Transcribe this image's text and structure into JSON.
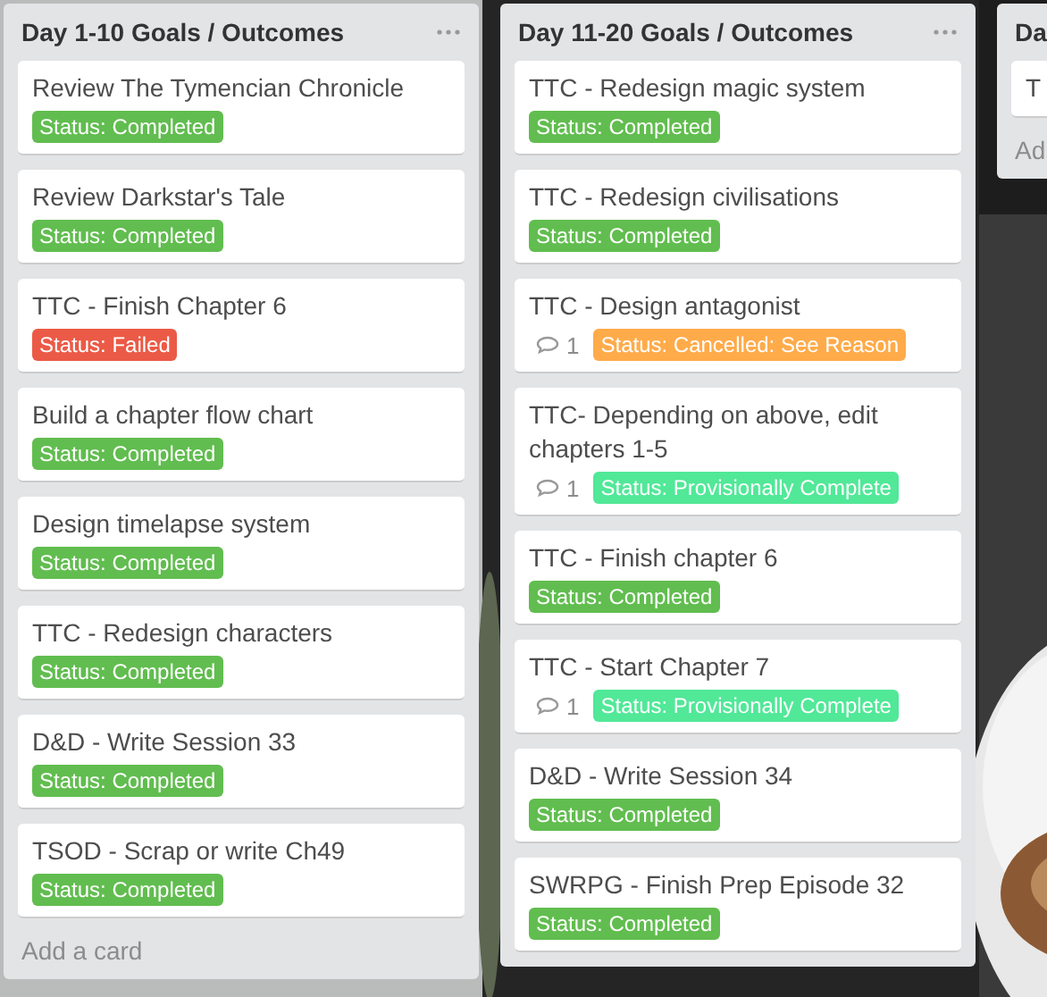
{
  "lists": [
    {
      "title": "Day 1-10 Goals / Outcomes",
      "menu": true,
      "cards": [
        {
          "title": "Review The Tymencian Chronicle",
          "labels": [
            {
              "text": "Status: Completed",
              "color": "#61bd4f"
            }
          ]
        },
        {
          "title": "Review Darkstar's Tale",
          "labels": [
            {
              "text": "Status: Completed",
              "color": "#61bd4f"
            }
          ]
        },
        {
          "title": "TTC - Finish Chapter 6",
          "labels": [
            {
              "text": "Status: Failed",
              "color": "#eb5a46"
            }
          ]
        },
        {
          "title": "Build a chapter flow chart",
          "labels": [
            {
              "text": "Status: Completed",
              "color": "#61bd4f"
            }
          ]
        },
        {
          "title": "Design timelapse system",
          "labels": [
            {
              "text": "Status: Completed",
              "color": "#61bd4f"
            }
          ]
        },
        {
          "title": "TTC - Redesign characters",
          "labels": [
            {
              "text": "Status: Completed",
              "color": "#61bd4f"
            }
          ]
        },
        {
          "title": "D&D - Write Session 33",
          "labels": [
            {
              "text": "Status: Completed",
              "color": "#61bd4f"
            }
          ]
        },
        {
          "title": "TSOD - Scrap or write Ch49",
          "labels": [
            {
              "text": "Status: Completed",
              "color": "#61bd4f"
            }
          ]
        }
      ],
      "add_card": "Add a card"
    },
    {
      "title": "Day 11-20 Goals / Outcomes",
      "menu": true,
      "cards": [
        {
          "title": "TTC - Redesign magic system",
          "labels": [
            {
              "text": "Status: Completed",
              "color": "#61bd4f"
            }
          ]
        },
        {
          "title": "TTC - Redesign civilisations",
          "labels": [
            {
              "text": "Status: Completed",
              "color": "#61bd4f"
            }
          ]
        },
        {
          "title": "TTC - Design antagonist",
          "comments": "1",
          "labels": [
            {
              "text": "Status: Cancelled: See Reason",
              "color": "#ffab4a"
            }
          ]
        },
        {
          "title": "TTC- Depending on above, edit chapters 1-5",
          "comments": "1",
          "labels": [
            {
              "text": "Status: Provisionally Complete",
              "color": "#51e898"
            }
          ]
        },
        {
          "title": "TTC - Finish chapter 6",
          "labels": [
            {
              "text": "Status: Completed",
              "color": "#61bd4f"
            }
          ]
        },
        {
          "title": "TTC - Start Chapter 7",
          "comments": "1",
          "labels": [
            {
              "text": "Status: Provisionally Complete",
              "color": "#51e898"
            }
          ]
        },
        {
          "title": "D&D - Write Session 34",
          "labels": [
            {
              "text": "Status: Completed",
              "color": "#61bd4f"
            }
          ]
        },
        {
          "title": "SWRPG - Finish Prep Episode 32",
          "labels": [
            {
              "text": "Status: Completed",
              "color": "#61bd4f"
            }
          ]
        }
      ]
    },
    {
      "title": "Da",
      "menu": false,
      "cards": [
        {
          "title": "T"
        }
      ],
      "add_card": "Ad"
    }
  ]
}
